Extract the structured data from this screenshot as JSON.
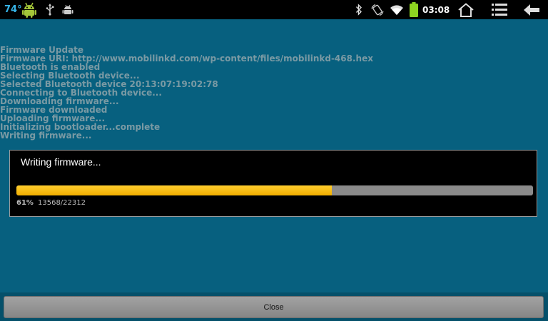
{
  "status_bar": {
    "temperature": "74°",
    "time": "03:08",
    "icons": [
      "android-icon",
      "usb-icon",
      "debug-icon",
      "bluetooth-icon",
      "rotation-icon",
      "wifi-icon",
      "battery-icon",
      "home-icon",
      "menu-icon",
      "back-icon"
    ]
  },
  "log": {
    "lines": [
      "Firmware Update",
      "Firmware URI: http://www.mobilinkd.com/wp-content/files/mobilinkd-468.hex",
      "Bluetooth is enabled",
      "Selecting Bluetooth device...",
      "Selected Bluetooth device 20:13:07:19:02:78",
      "Connecting to Bluetooth device...",
      "Downloading firmware...",
      "Firmware downloaded",
      "Uploading firmware...",
      "Initializing bootloader...complete",
      "Writing firmware..."
    ]
  },
  "dialog": {
    "title": "Writing firmware...",
    "percent_label": "61%",
    "count_label": "13568/22312",
    "progress_fraction": 0.61
  },
  "buttons": {
    "close_label": "Close"
  },
  "colors": {
    "background": "#07607f",
    "log_text": "#7a9aa4",
    "progress_fill": "#f5b800",
    "progress_track": "#8a8a8a",
    "temperature": "#36b3e6",
    "battery": "#8ed321"
  }
}
